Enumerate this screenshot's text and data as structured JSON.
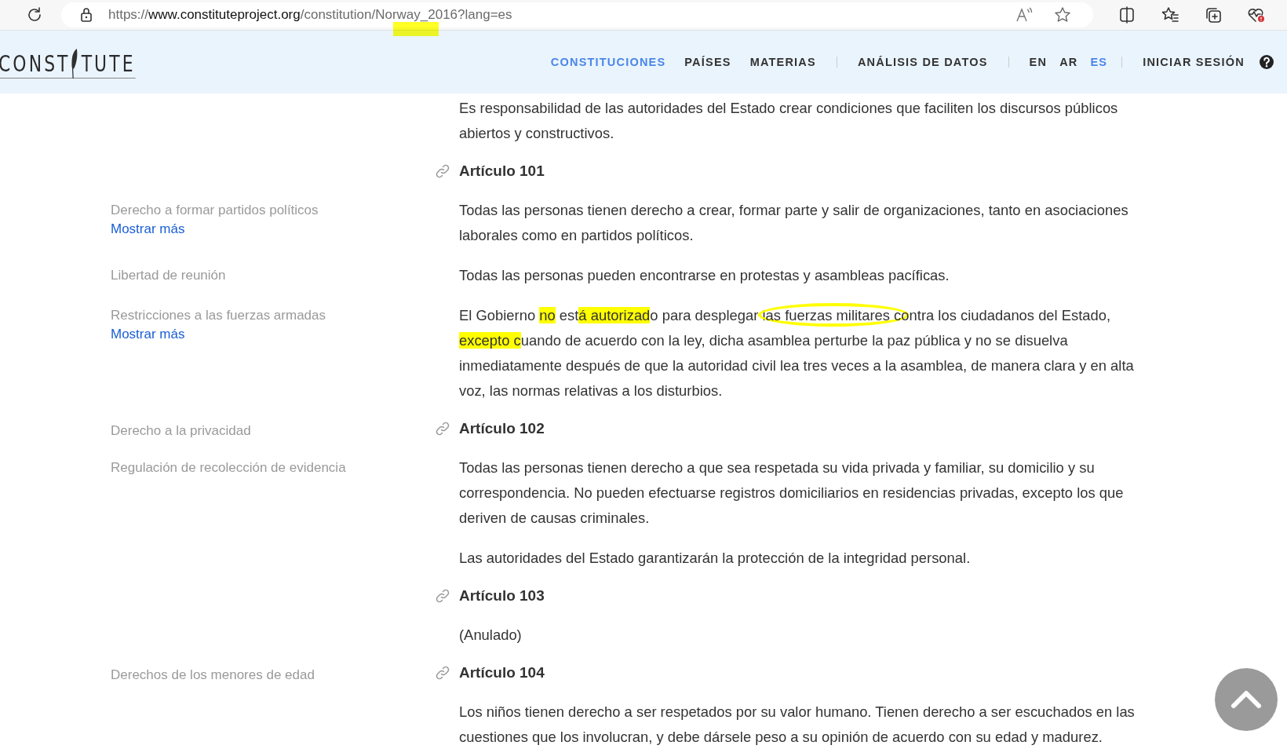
{
  "browser": {
    "url_scheme": "https://",
    "url_host": "www.constituteproject.org",
    "url_path": "/constitution/Norway_2016?lang=es"
  },
  "site": {
    "logo_left": "CONST",
    "logo_right": "TUTE",
    "nav": [
      {
        "kind": "link",
        "label": "CONSTITUCIONES",
        "selected": true
      },
      {
        "kind": "link",
        "label": "PAÍSES",
        "selected": false
      },
      {
        "kind": "link",
        "label": "MATERIAS",
        "selected": false
      },
      {
        "kind": "divider"
      },
      {
        "kind": "link",
        "label": "ANÁLISIS DE DATOS",
        "selected": false
      },
      {
        "kind": "divider"
      },
      {
        "kind": "lang",
        "label": "EN",
        "selected": false
      },
      {
        "kind": "lang",
        "label": "AR",
        "selected": false
      },
      {
        "kind": "lang",
        "label": "ES",
        "selected": true
      },
      {
        "kind": "divider"
      },
      {
        "kind": "link",
        "label": "INICIAR SESIÓN",
        "selected": false
      },
      {
        "kind": "help"
      }
    ]
  },
  "rows": [
    {
      "kind": "text",
      "text": "Es responsabilidad de las autoridades del Estado crear condiciones que faciliten los discursos públicos abiertos y constructivos."
    },
    {
      "kind": "article",
      "text": "Artículo 101"
    },
    {
      "kind": "text",
      "topic": "Derecho a formar partidos políticos",
      "more": "Mostrar más",
      "text": "Todas las personas tienen derecho a crear, formar parte y salir de organizaciones, tanto en asociaciones laborales como en partidos políticos."
    },
    {
      "kind": "text",
      "topic": "Libertad de reunión",
      "text": "Todas las personas pueden encontrarse en protestas y asambleas pacíficas."
    },
    {
      "kind": "text",
      "topic": "Restricciones a las fuerzas armadas",
      "more": "Mostrar más",
      "segments": [
        {
          "text": "El Gobierno ",
          "highlighted": false,
          "circled": false
        },
        {
          "text": "no",
          "highlighted": true,
          "circled": false
        },
        {
          "text": " est",
          "highlighted": false,
          "circled": false
        },
        {
          "text": "á autorizad",
          "highlighted": true,
          "circled": false
        },
        {
          "text": "o para desplegar l",
          "highlighted": false,
          "circled": false
        },
        {
          "text": "as fuerzas militares c",
          "highlighted": false,
          "circled": true
        },
        {
          "text": "ontra los ciudadanos del Estado, ",
          "highlighted": false,
          "circled": false
        },
        {
          "text": "excepto c",
          "highlighted": true,
          "circled": false
        },
        {
          "text": "uando de acuerdo con la ley, dicha asamblea perturbe la paz pública y no se disuelva inmediatamente después de que la autoridad civil lea tres veces a la asamblea, de manera clara y en alta voz, las normas relativas a los disturbios.",
          "highlighted": false,
          "circled": false
        }
      ]
    },
    {
      "kind": "article",
      "topic": "Derecho a la privacidad",
      "text": "Artículo 102"
    },
    {
      "kind": "text",
      "topic": "Regulación de recolección de evidencia",
      "text": "Todas las personas tienen derecho a que sea respetada su vida privada y familiar, su domicilio y su correspondencia. No pueden efectuarse registros domiciliarios en residencias privadas, excepto los que deriven de causas criminales."
    },
    {
      "kind": "text",
      "text": "Las autoridades del Estado garantizarán la protección de la integridad personal."
    },
    {
      "kind": "article",
      "text": "Artículo 103"
    },
    {
      "kind": "text",
      "text": "(Anulado)"
    },
    {
      "kind": "article",
      "topic": "Derechos de los menores de edad",
      "text": "Artículo 104"
    },
    {
      "kind": "text",
      "text": "Los niños tienen derecho a ser respetados por su valor humano. Tienen derecho a ser escuchados en las cuestiones que los involucran, y debe dársele peso a su opinión de acuerdo con su edad y madurez."
    }
  ]
}
